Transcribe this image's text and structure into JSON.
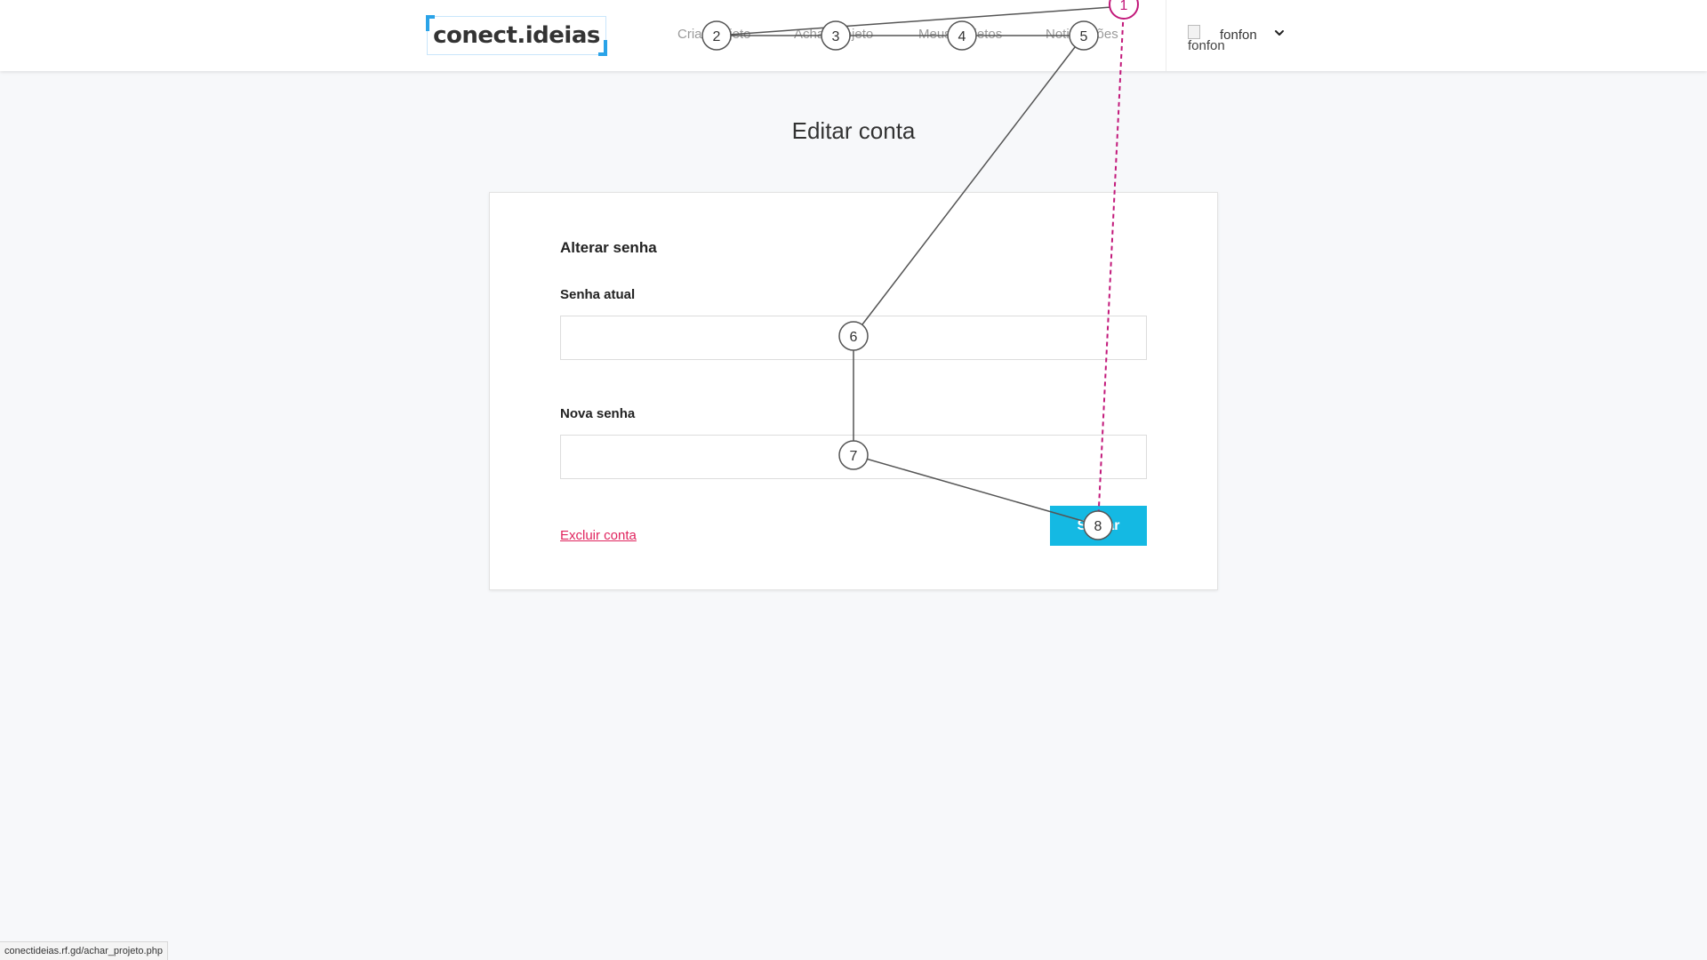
{
  "header": {
    "logo_text": "conect.ideias",
    "nav": [
      {
        "label": "Criar projeto"
      },
      {
        "label": "Achar projeto"
      },
      {
        "label": "Meus projetos"
      },
      {
        "label": "Notificações"
      }
    ],
    "user": {
      "avatar_alt": "fonfon",
      "name": "fonfon"
    }
  },
  "page": {
    "title": "Editar conta"
  },
  "form": {
    "section_title": "Alterar senha",
    "current_password_label": "Senha atual",
    "current_password_value": "",
    "new_password_label": "Nova senha",
    "new_password_value": "",
    "delete_link": "Excluir conta",
    "save_button": "Salvar"
  },
  "status_bar": {
    "url": "conectideias.rf.gd/achar_projeto.php"
  },
  "annotations": {
    "badges": [
      "1",
      "2",
      "3",
      "4",
      "5",
      "6",
      "7",
      "8"
    ],
    "colors": {
      "neutral": "#555555",
      "highlight": "#c2187a"
    }
  },
  "colors": {
    "accent": "#14b9e3",
    "danger_link": "#e0245e",
    "logo_corner": "#2aa3e8",
    "background": "#f7f8fa"
  }
}
